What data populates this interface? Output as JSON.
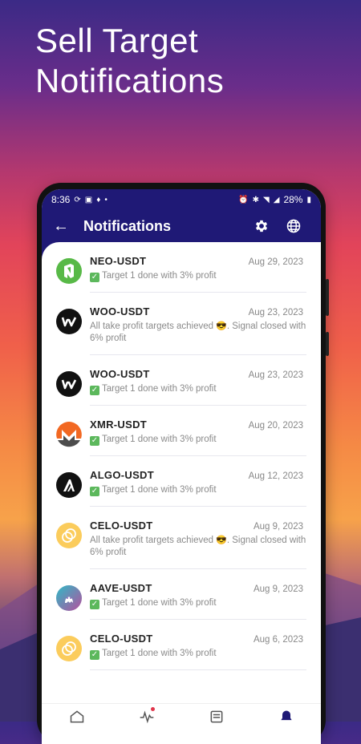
{
  "headline": {
    "line1": "Sell Target",
    "line2": "Notifications"
  },
  "statusbar": {
    "time": "8:36",
    "battery": "28%"
  },
  "appbar": {
    "title": "Notifications"
  },
  "notifications": [
    {
      "pair": "NEO-USDT",
      "date": "Aug 29, 2023",
      "message": "Target 1 done with 3% profit",
      "coin_icon": "neo-icon",
      "color": "#58b947",
      "kind": "target"
    },
    {
      "pair": "WOO-USDT",
      "date": "Aug 23, 2023",
      "message": "All take profit targets achieved",
      "message2": ". Signal closed with 6% profit",
      "coin_icon": "woo-icon",
      "color": "#111111",
      "kind": "all"
    },
    {
      "pair": "WOO-USDT",
      "date": "Aug 23, 2023",
      "message": "Target 1 done with 3% profit",
      "coin_icon": "woo-icon",
      "color": "#111111",
      "kind": "target"
    },
    {
      "pair": "XMR-USDT",
      "date": "Aug 20, 2023",
      "message": "Target 1 done with 3% profit",
      "coin_icon": "monero-icon",
      "color": "#f26822",
      "kind": "target"
    },
    {
      "pair": "ALGO-USDT",
      "date": "Aug 12, 2023",
      "message": "Target 1 done with 3% profit",
      "coin_icon": "algorand-icon",
      "color": "#111111",
      "kind": "target"
    },
    {
      "pair": "CELO-USDT",
      "date": "Aug 9, 2023",
      "message": "All take profit targets achieved",
      "message2": ". Signal closed with 6% profit",
      "coin_icon": "celo-icon",
      "color": "#fbcc5c",
      "kind": "all"
    },
    {
      "pair": "AAVE-USDT",
      "date": "Aug 9, 2023",
      "message": "Target 1 done with 3% profit",
      "coin_icon": "aave-icon",
      "color": "#8b5fbf",
      "kind": "target"
    },
    {
      "pair": "CELO-USDT",
      "date": "Aug 6, 2023",
      "message": "Target 1 done with 3% profit",
      "coin_icon": "celo-icon",
      "color": "#fbcc5c",
      "kind": "target"
    }
  ],
  "colors": {
    "appbar": "#1f1976",
    "accent": "#1f1976",
    "badge": "#e0344a"
  }
}
